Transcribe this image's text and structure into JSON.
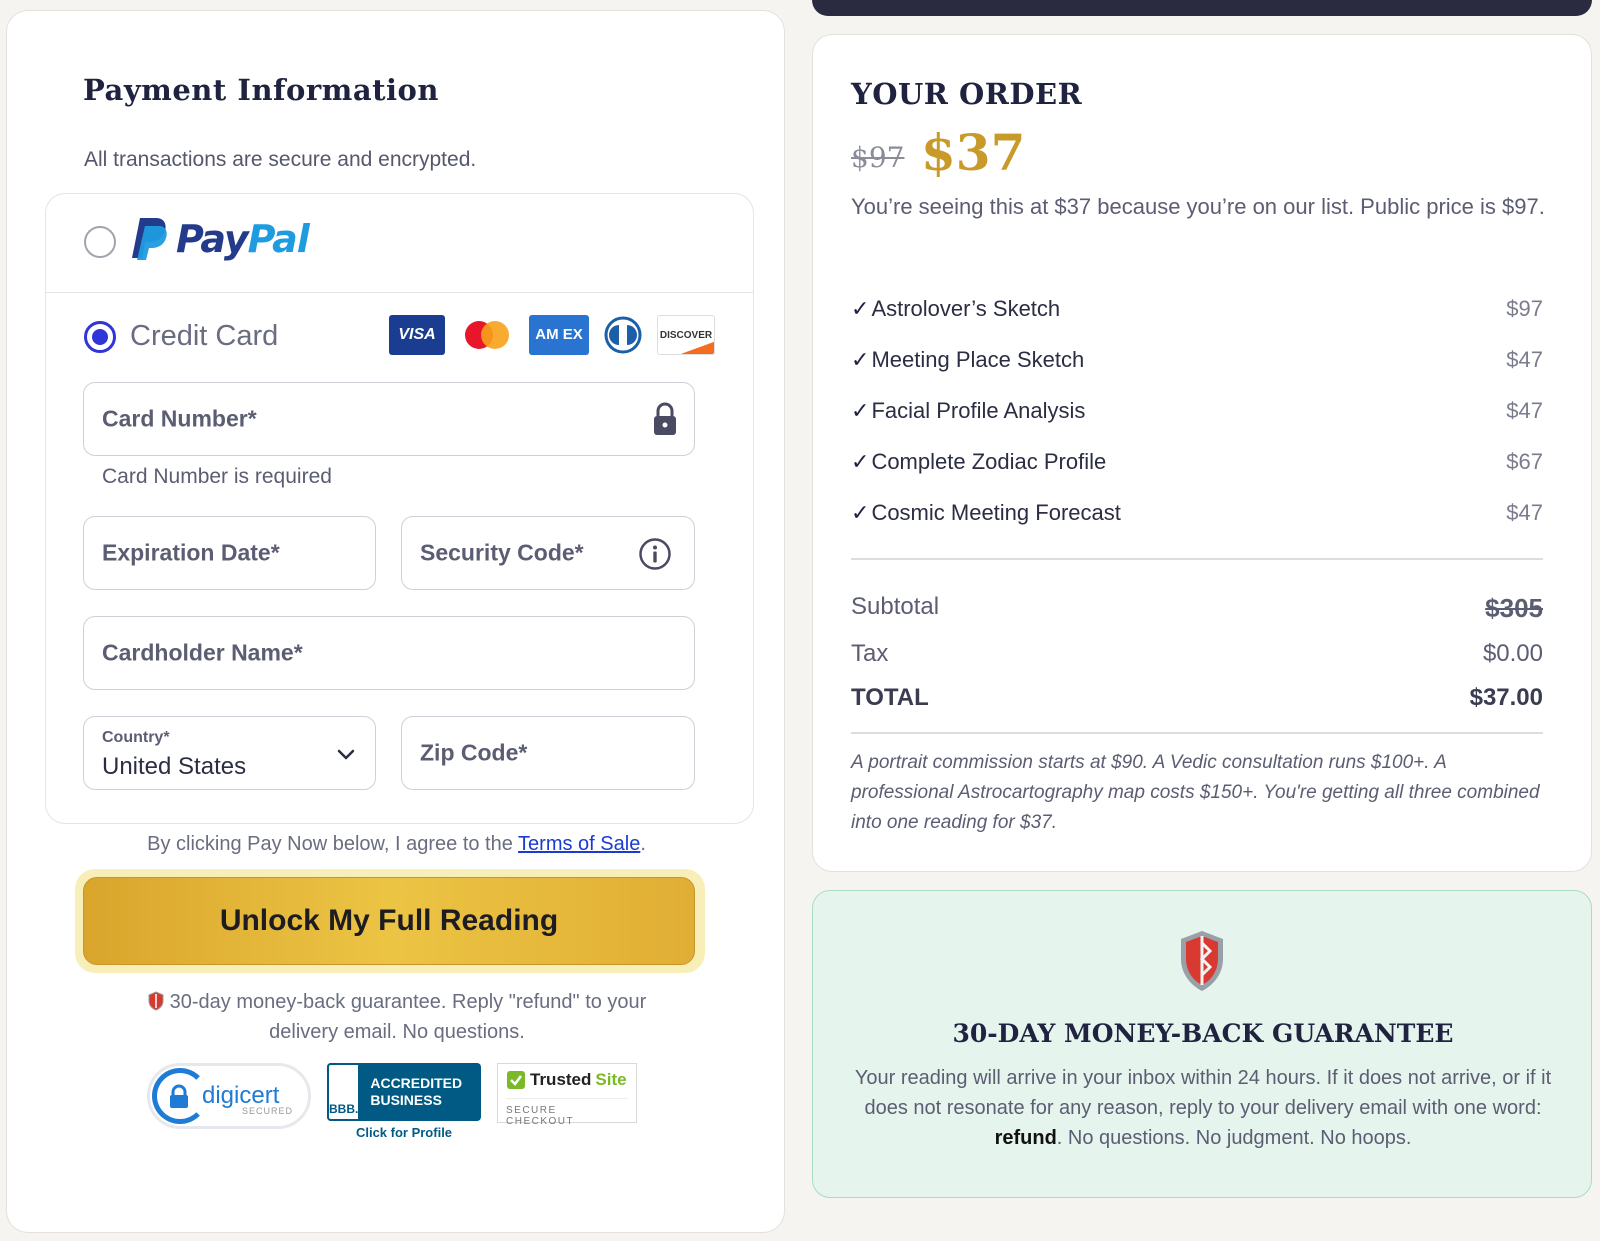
{
  "payment": {
    "title": "Payment Information",
    "subtitle": "All transactions are secure and encrypted.",
    "paypal": {
      "brand_part1": "Pay",
      "brand_part2": "Pal",
      "selected": false
    },
    "credit_card": {
      "label": "Credit Card",
      "selected": true,
      "card_logos": [
        "VISA",
        "AM EX",
        "DISCOVER"
      ]
    },
    "fields": {
      "card_number": "Card Number*",
      "card_number_error": "Card Number is required",
      "expiration": "Expiration Date*",
      "security_code": "Security Code*",
      "cardholder": "Cardholder Name*",
      "country_label": "Country*",
      "country_value": "United States",
      "zip": "Zip Code*"
    },
    "terms_prefix": "By clicking Pay Now below, I agree to the ",
    "terms_link": "Terms of Sale",
    "terms_suffix": ".",
    "cta_label": "Unlock My Full Reading",
    "guarantee_note": "30-day money-back guarantee. Reply \"refund\" to your delivery email. No questions.",
    "badges": {
      "digicert": "digicert",
      "digicert_sub": "SECURED",
      "bbb_logo": "BBB.",
      "bbb_text": "ACCREDITED BUSINESS",
      "bbb_click": "Click for Profile",
      "trusted_part1": "Trusted",
      "trusted_part2": "Site",
      "trusted_sub": "SECURE CHECKOUT"
    }
  },
  "order": {
    "title": "YOUR ORDER",
    "old_price": "$97",
    "new_price": "$37",
    "list_note": "You’re seeing this at $37 because you’re on our list. Public price is $97.",
    "items": [
      {
        "check": "✓",
        "name": "Astrolover’s Sketch",
        "price": "$97"
      },
      {
        "check": "✓",
        "name": "Meeting Place Sketch",
        "price": "$47"
      },
      {
        "check": "✓",
        "name": "Facial Profile Analysis",
        "price": "$47"
      },
      {
        "check": "✓",
        "name": "Complete Zodiac Profile",
        "price": "$67"
      },
      {
        "check": "✓",
        "name": "Cosmic Meeting Forecast",
        "price": "$47"
      }
    ],
    "subtotal_label": "Subtotal",
    "subtotal_value": "$305",
    "tax_label": "Tax",
    "tax_value": "$0.00",
    "total_label": "TOTAL",
    "total_value": "$37.00",
    "value_note": "A portrait commission starts at $90. A Vedic consultation runs $100+. A professional Astrocartography map costs $150+. You're getting all three combined into one reading for $37."
  },
  "guarantee": {
    "title": "30-DAY MONEY-BACK GUARANTEE",
    "body_prefix": "Your reading will arrive in your inbox within 24 hours. If it does not arrive, or if it does not resonate for any reason, reply to your delivery email with one word: ",
    "body_bold": "refund",
    "body_suffix": ". No questions. No judgment. No hoops."
  },
  "colors": {
    "accent_blue": "#2f35d6",
    "gold_price": "#c89a2a",
    "cta_gold": "#e6b93a",
    "guarantee_bg": "#e6f4ee",
    "title_navy": "#1f2340"
  }
}
